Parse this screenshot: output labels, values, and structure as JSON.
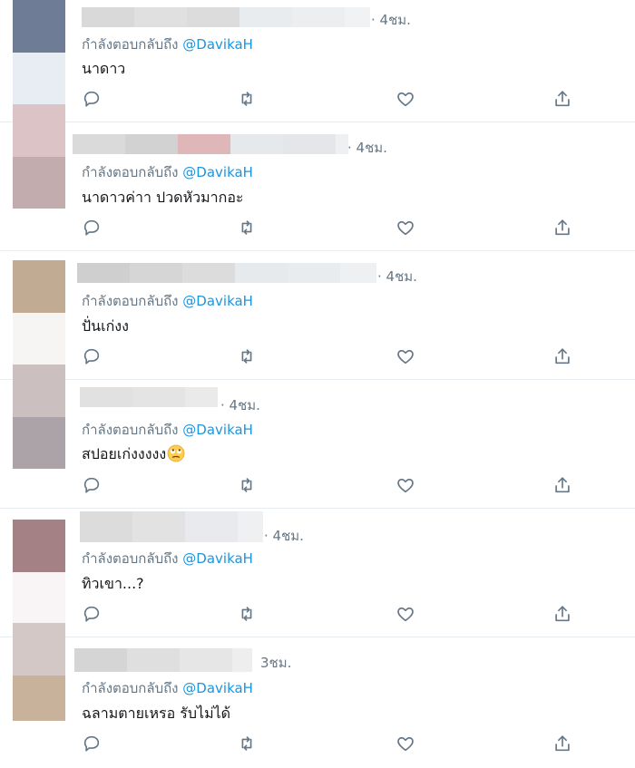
{
  "reply_prefix": "กำลังตอบกลับถึง",
  "reply_handle": "@DavikaH",
  "colors": {
    "muted": "#657786",
    "link": "#1b95e0",
    "divider": "#e6ecf0",
    "text": "#14171a"
  },
  "icons": [
    "reply-icon",
    "retweet-icon",
    "like-icon",
    "share-icon"
  ],
  "tweets": [
    {
      "time": "· 4ชม.",
      "text": "นาดาว",
      "emoji": ""
    },
    {
      "time": "· 4ชม.",
      "text": "นาดาวค่าา ปวดหัวมากอะ",
      "emoji": ""
    },
    {
      "time": "· 4ชม.",
      "text": "ปั่นเก่งง",
      "emoji": ""
    },
    {
      "time": "· 4ชม.",
      "text": "สปอยเก่งงงงง",
      "emoji": "face-with-rolling-eyes"
    },
    {
      "time": "· 4ชม.",
      "text": "ทิวเขา...?",
      "emoji": ""
    },
    {
      "time": "3ชม.",
      "text": "ฉลามตายเหรอ รับไม่ได้",
      "emoji": ""
    }
  ]
}
